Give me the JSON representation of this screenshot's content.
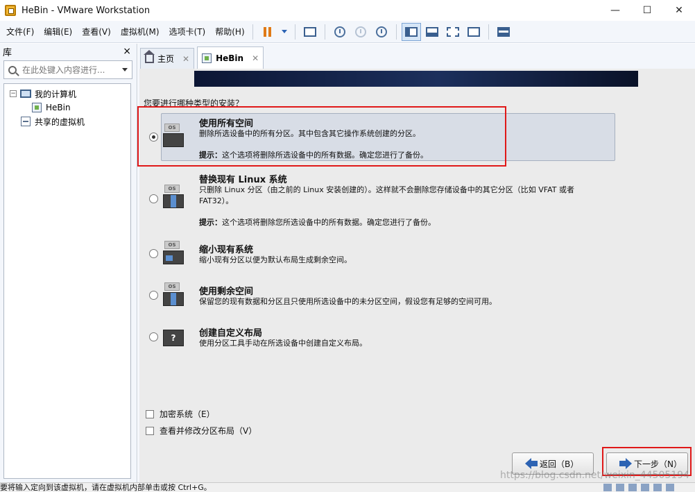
{
  "window": {
    "title": "HeBin - VMware Workstation",
    "minimize": "—",
    "maximize": "☐",
    "close": "✕"
  },
  "menu": [
    "文件(F)",
    "编辑(E)",
    "查看(V)",
    "虚拟机(M)",
    "选项卡(T)",
    "帮助(H)"
  ],
  "library": {
    "title": "库",
    "close": "×",
    "search_placeholder": "在此处键入内容进行...",
    "tree": {
      "my_computer": "我的计算机",
      "vm_name": "HeBin",
      "shared": "共享的虚拟机"
    }
  },
  "tabs": [
    {
      "label": "主页"
    },
    {
      "label": "HeBin"
    }
  ],
  "installer": {
    "question": "您要进行哪种类型的安装？",
    "options": [
      {
        "title": "使用所有空间",
        "desc": "删除所选设备中的所有分区。其中包含其它操作系统创建的分区。",
        "hint_label": "提示：",
        "hint": "这个选项将删除所选设备中的所有数据。确定您进行了备份。",
        "selected": true
      },
      {
        "title": "替换现有 Linux 系统",
        "desc": "只删除 Linux 分区（由之前的 Linux 安装创建的）。这样就不会删除您存储设备中的其它分区（比如 VFAT 或者 FAT32）。",
        "hint_label": "提示：",
        "hint": "这个选项将删除您所选设备中的所有数据。确定您进行了备份。",
        "selected": false
      },
      {
        "title": "缩小现有系统",
        "desc": "缩小现有分区以便为默认布局生成剩余空间。",
        "selected": false
      },
      {
        "title": "使用剩余空间",
        "desc": "保留您的现有数据和分区且只使用所选设备中的未分区空间，假设您有足够的空间可用。",
        "selected": false
      },
      {
        "title": "创建自定义布局",
        "desc": "使用分区工具手动在所选设备中创建自定义布局。",
        "selected": false
      }
    ],
    "disk_label": "OS",
    "question_mark": "?",
    "encrypt": "加密系统（E）",
    "review": "查看并修改分区布局（V）",
    "back": "返回（B）",
    "next": "下一步（N）"
  },
  "watermark": "https://blog.csdn.net/weixin_44505194",
  "status": "要将输入定向到该虚拟机，请在虚拟机内部单击或按 Ctrl+G。"
}
